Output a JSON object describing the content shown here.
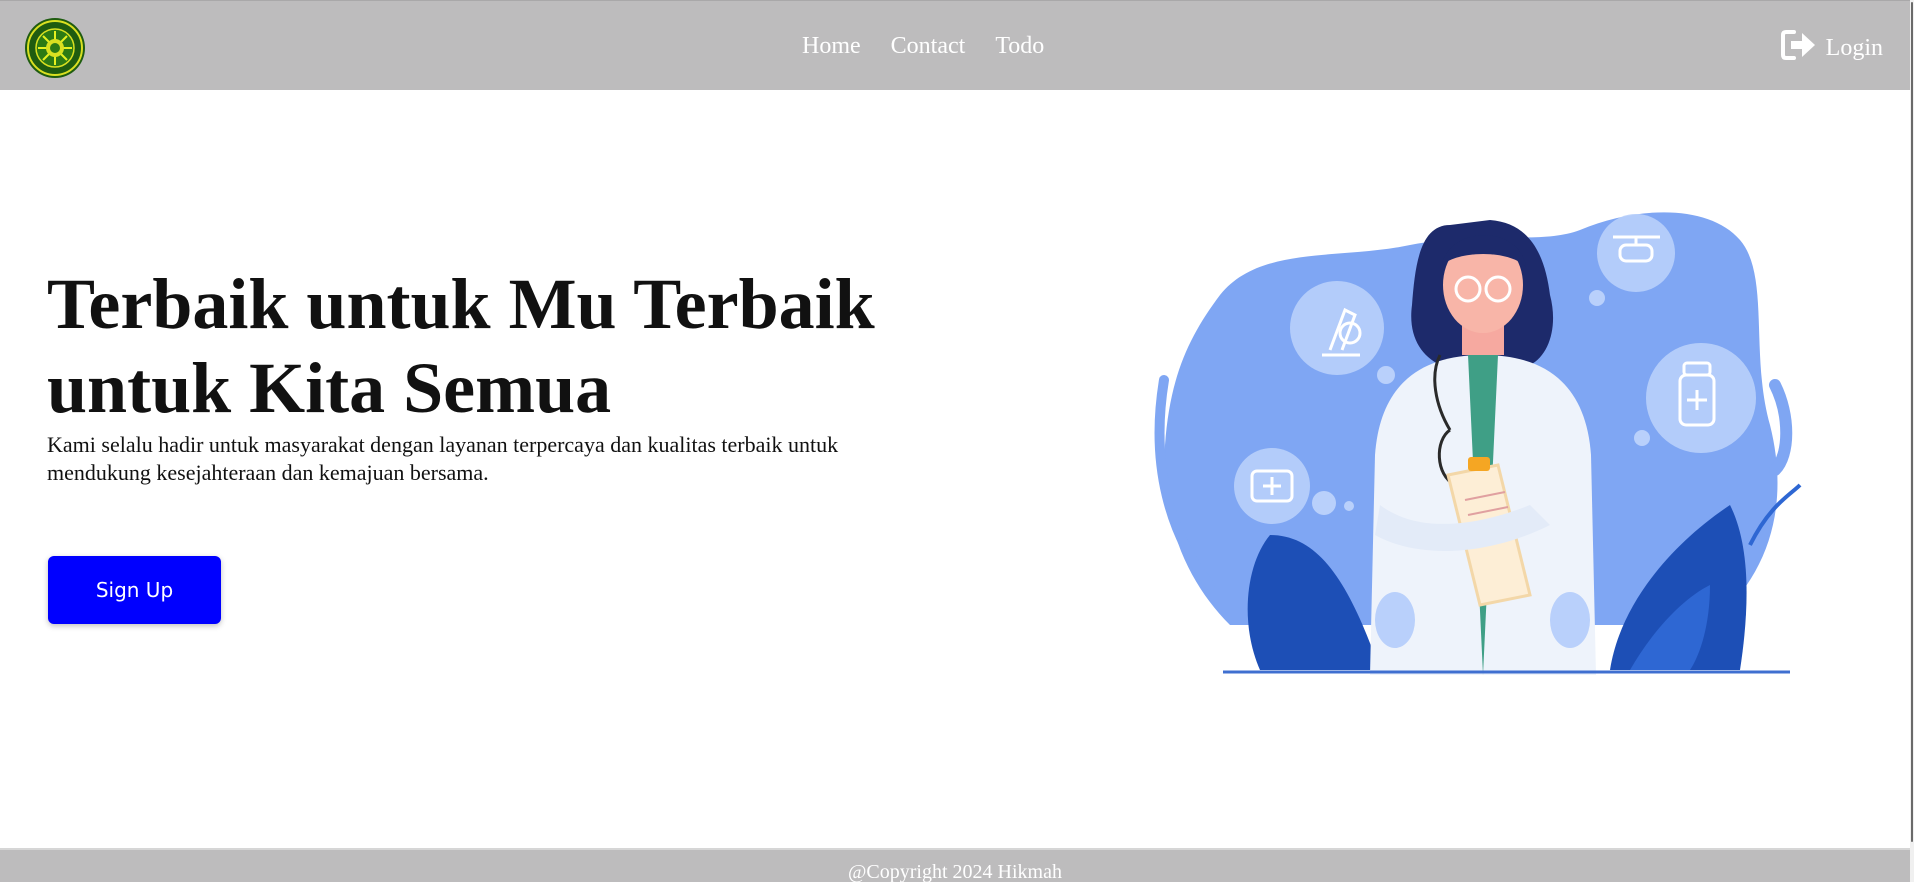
{
  "navbar": {
    "logo_icon": "university-seal-icon",
    "links": [
      {
        "label": "Home"
      },
      {
        "label": "Contact"
      },
      {
        "label": "Todo"
      }
    ],
    "login": {
      "label": "Login",
      "icon": "login-arrow-icon"
    }
  },
  "hero": {
    "title": "Terbaik untuk Mu Terbaik untuk Kita Semua",
    "description": "Kami selalu hadir untuk masyarakat dengan layanan terpercaya dan kualitas terbaik untuk mendukung kesejahteraan dan kemajuan bersama.",
    "signup_label": "Sign Up",
    "illustration": "doctor-illustration"
  },
  "footer": {
    "copyright": "@Copyright 2024 Hikmah"
  },
  "colors": {
    "navbar_bg": "#bdbcbd",
    "primary_button": "#0000ff",
    "illustration_blue": "#7fa6f3"
  }
}
